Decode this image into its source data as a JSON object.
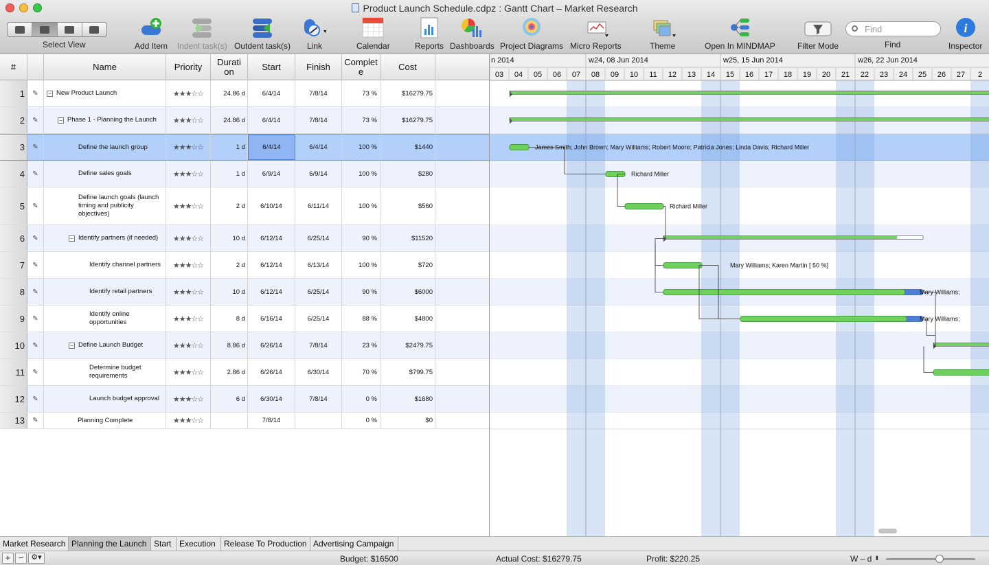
{
  "window": {
    "title": "Product Launch Schedule.cdpz : Gantt Chart – Market Research"
  },
  "toolbar": {
    "select_view": "Select View",
    "add_item": "Add Item",
    "indent": "Indent task(s)",
    "outdent": "Outdent task(s)",
    "link": "Link",
    "calendar": "Calendar",
    "reports": "Reports",
    "dashboards": "Dashboards",
    "project_diagrams": "Project Diagrams",
    "micro_reports": "Micro Reports",
    "theme": "Theme",
    "open_mindmap": "Open In MINDMAP",
    "filter_mode": "Filter Mode",
    "find_label": "Find",
    "find_placeholder": "Find",
    "inspector": "Inspector"
  },
  "columns": {
    "num": "#",
    "name": "Name",
    "priority": "Priority",
    "duration": "Duration",
    "start": "Start",
    "finish": "Finish",
    "complete": "Complete",
    "cost": "Cost"
  },
  "tasks": [
    {
      "num": "1",
      "name": "New Product Launch",
      "priority": "★★★☆☆",
      "duration": "24.86 d",
      "start": "6/4/14",
      "finish": "7/8/14",
      "complete": "73 %",
      "cost": "$16279.75"
    },
    {
      "num": "2",
      "name": "Phase 1 - Planning the Launch",
      "priority": "★★★☆☆",
      "duration": "24.86 d",
      "start": "6/4/14",
      "finish": "7/8/14",
      "complete": "73 %",
      "cost": "$16279.75"
    },
    {
      "num": "3",
      "name": "Define the launch group",
      "priority": "★★★☆☆",
      "duration": "1 d",
      "start": "6/4/14",
      "finish": "6/4/14",
      "complete": "100 %",
      "cost": "$1440"
    },
    {
      "num": "4",
      "name": "Define sales goals",
      "priority": "★★★☆☆",
      "duration": "1 d",
      "start": "6/9/14",
      "finish": "6/9/14",
      "complete": "100 %",
      "cost": "$280"
    },
    {
      "num": "5",
      "name": "Define launch goals (launch timing and publicity objectives)",
      "priority": "★★★☆☆",
      "duration": "2 d",
      "start": "6/10/14",
      "finish": "6/11/14",
      "complete": "100 %",
      "cost": "$560"
    },
    {
      "num": "6",
      "name": "Identify partners (if needed)",
      "priority": "★★★☆☆",
      "duration": "10 d",
      "start": "6/12/14",
      "finish": "6/25/14",
      "complete": "90 %",
      "cost": "$11520"
    },
    {
      "num": "7",
      "name": "Identify channel partners",
      "priority": "★★★☆☆",
      "duration": "2 d",
      "start": "6/12/14",
      "finish": "6/13/14",
      "complete": "100 %",
      "cost": "$720"
    },
    {
      "num": "8",
      "name": "Identify retail partners",
      "priority": "★★★☆☆",
      "duration": "10 d",
      "start": "6/12/14",
      "finish": "6/25/14",
      "complete": "90 %",
      "cost": "$6000"
    },
    {
      "num": "9",
      "name": "Identify online opportunities",
      "priority": "★★★☆☆",
      "duration": "8 d",
      "start": "6/16/14",
      "finish": "6/25/14",
      "complete": "88 %",
      "cost": "$4800"
    },
    {
      "num": "10",
      "name": "Define Launch Budget",
      "priority": "★★★☆☆",
      "duration": "8.86 d",
      "start": "6/26/14",
      "finish": "7/8/14",
      "complete": "23 %",
      "cost": "$2479.75"
    },
    {
      "num": "11",
      "name": "Determine budget requirements",
      "priority": "★★★☆☆",
      "duration": "2.86 d",
      "start": "6/26/14",
      "finish": "6/30/14",
      "complete": "70 %",
      "cost": "$799.75"
    },
    {
      "num": "12",
      "name": "Launch budget approval",
      "priority": "★★★☆☆",
      "duration": "6 d",
      "start": "6/30/14",
      "finish": "7/8/14",
      "complete": "0 %",
      "cost": "$1680"
    },
    {
      "num": "13",
      "name": "Planning Complete",
      "priority": "★★★☆☆",
      "duration": "",
      "start": "7/8/14",
      "finish": "",
      "complete": "0 %",
      "cost": "$0"
    }
  ],
  "timeline": {
    "weeks": [
      "n 2014",
      "w24, 08 Jun 2014",
      "w25, 15 Jun 2014",
      "w26, 22 Jun 2014"
    ],
    "days": [
      "03",
      "04",
      "05",
      "06",
      "07",
      "08",
      "09",
      "10",
      "11",
      "12",
      "13",
      "14",
      "15",
      "16",
      "17",
      "18",
      "19",
      "20",
      "21",
      "22",
      "23",
      "24",
      "25",
      "26",
      "27",
      "2"
    ],
    "resources": [
      {
        "row": 3,
        "text": "James Smith; John Brown; Mary Williams; Robert Moore; Patricia Jones; Linda Davis; Richard Miller"
      },
      {
        "row": 4,
        "text": "Richard Miller"
      },
      {
        "row": 5,
        "text": "Richard Miller"
      },
      {
        "row": 7,
        "text": "Mary Williams; Karen Martin [ 50 %]"
      },
      {
        "row": 8,
        "text": "Mary Williams;"
      },
      {
        "row": 9,
        "text": "Mary Williams;"
      }
    ]
  },
  "sheet_tabs": [
    "Market Research",
    "Planning the Launch",
    "Start",
    "Execution",
    "Release To Production",
    "Advertising Campaign"
  ],
  "status": {
    "budget": "Budget: $16500",
    "actual_cost": "Actual Cost: $16279.75",
    "profit": "Profit: $220.25",
    "zoom": "W – d"
  },
  "colors": {
    "bar_green": "#6fd15b",
    "bar_blue": "#4f7fd6",
    "weekend": "#cfdff3",
    "selection": "#b3d0fb"
  }
}
